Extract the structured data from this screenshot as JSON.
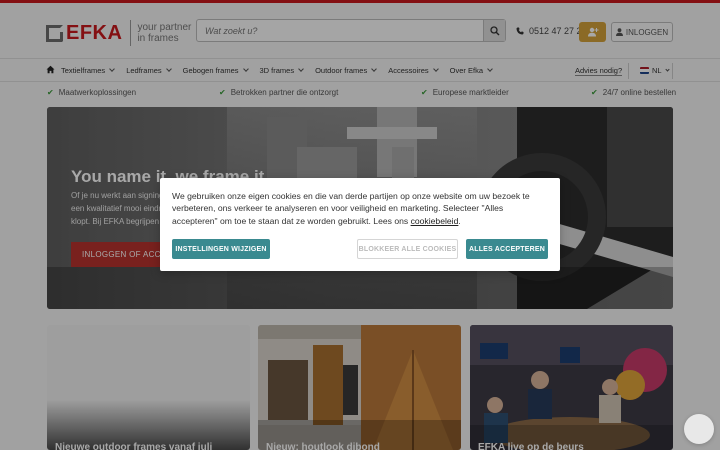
{
  "brand": {
    "name": "EFKA",
    "tagline_line1": "your partner",
    "tagline_line2": "in frames",
    "accent": "#c8191e"
  },
  "header": {
    "search_placeholder": "Wat zoekt u?",
    "phone": "0512 47 27 21",
    "login_label": "INLOGGEN"
  },
  "nav": {
    "items": [
      {
        "label": "Textielframes"
      },
      {
        "label": "Ledframes"
      },
      {
        "label": "Gebogen frames"
      },
      {
        "label": "3D frames"
      },
      {
        "label": "Outdoor frames"
      },
      {
        "label": "Accessoires"
      },
      {
        "label": "Over Efka"
      }
    ],
    "advice_label": "Advies nodig?",
    "language": "NL"
  },
  "usps": [
    {
      "label": "Maatwerkoplossingen"
    },
    {
      "label": "Betrokken partner die ontzorgt"
    },
    {
      "label": "Europese marktleider"
    },
    {
      "label": "24/7 online bestellen"
    }
  ],
  "hero": {
    "title": "You name it, we frame it",
    "text": "Of je nu werkt aan signing, retail of een beurs: je wilt een kwalitatief mooi eindresultaat waarbij elk detail klopt. Bij EFKA begrijpen we dat als geen ander.",
    "button_label": "INLOGGEN OF ACCOUNT AANVRAGEN"
  },
  "cards": [
    {
      "title": "Nieuwe outdoor frames vanaf juli"
    },
    {
      "title": "Nieuw: houtlook dibond"
    },
    {
      "title": "EFKA live op de beurs"
    }
  ],
  "cookie": {
    "text_before_link": "We gebruiken onze eigen cookies en die van derde partijen op onze website om uw bezoek te verbeteren, ons verkeer te analyseren en voor veiligheid en marketing. Selecteer \"Alles accepteren\" om toe te staan dat ze worden gebruikt. Lees ons ",
    "link_label": "cookiebeleid",
    "text_after_link": ".",
    "settings_label": "INSTELLINGEN WIJZIGEN",
    "block_label": "BLOKKEER ALLE COOKIES",
    "accept_label": "ALLES ACCEPTEREN",
    "button_color": "#3a8a90"
  },
  "icons": {
    "search": "search-icon",
    "phone": "phone-icon",
    "user_add": "user-plus-icon",
    "user": "user-icon",
    "home": "home-icon",
    "check": "check-icon",
    "chat": "chat-icon"
  }
}
